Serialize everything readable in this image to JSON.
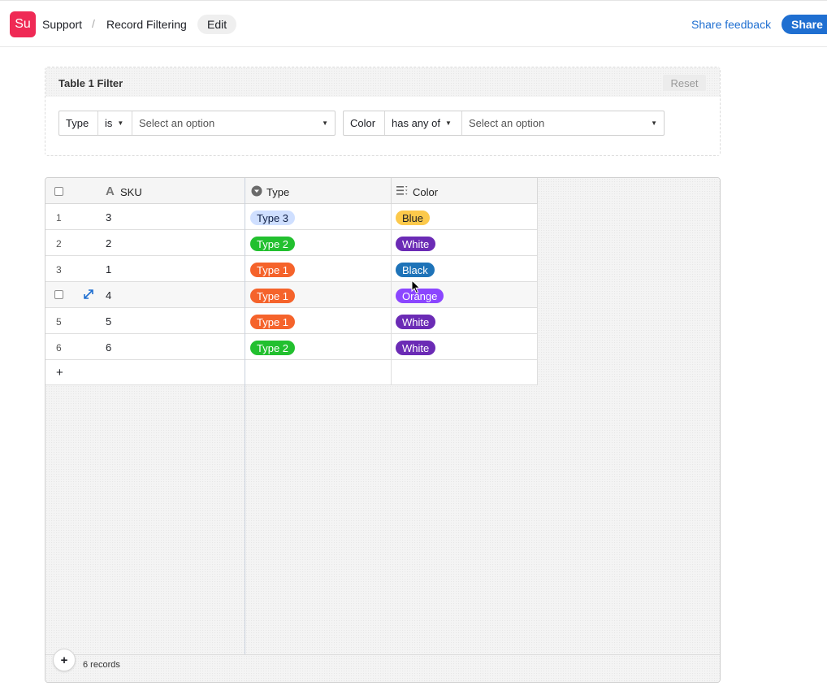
{
  "topbar": {
    "logo": "Su",
    "crumb_app": "Support",
    "crumb_sep": "/",
    "crumb_page": "Record Filtering",
    "edit_label": "Edit",
    "share_feedback": "Share feedback",
    "share_label": "Share"
  },
  "filter": {
    "title": "Table 1 Filter",
    "reset_label": "Reset",
    "groups": [
      {
        "field": "Type",
        "operator": "is",
        "placeholder": "Select an option"
      },
      {
        "field": "Color",
        "operator": "has any of",
        "placeholder": "Select an option"
      }
    ]
  },
  "grid": {
    "columns": {
      "sku": "SKU",
      "type": "Type",
      "color": "Color"
    },
    "column_icons": {
      "sku": "text-a-icon",
      "type": "single-select-icon",
      "color": "multi-select-icon"
    },
    "rows": [
      {
        "num": "1",
        "sku": "3",
        "type": "Type 3",
        "color": "Blue"
      },
      {
        "num": "2",
        "sku": "2",
        "type": "Type 2",
        "color": "White"
      },
      {
        "num": "3",
        "sku": "1",
        "type": "Type 1",
        "color": "Black"
      },
      {
        "num": "",
        "sku": "4",
        "type": "Type 1",
        "color": "Orange"
      },
      {
        "num": "5",
        "sku": "5",
        "type": "Type 1",
        "color": "White"
      },
      {
        "num": "6",
        "sku": "6",
        "type": "Type 2",
        "color": "White"
      }
    ],
    "add_row": "+",
    "add_button": "+",
    "record_count": "6 records"
  },
  "colors": {
    "brand": "#ef2a55",
    "link": "#1f6fd1",
    "type_1": "#f5632b",
    "type_2": "#22c02f",
    "type_3": "#cfdfff",
    "blue": "#fcc94b",
    "white": "#6b2bb5",
    "black": "#1e73b8",
    "orange": "#8b46ff"
  }
}
